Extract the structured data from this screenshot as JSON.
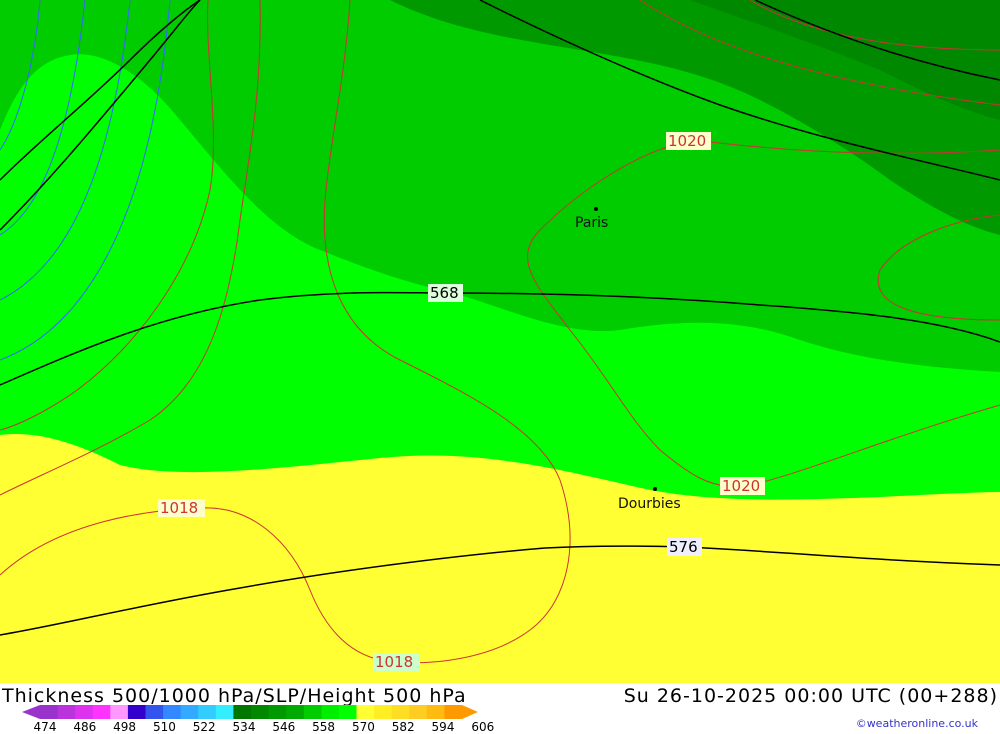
{
  "map": {
    "cities": [
      {
        "name": "Paris"
      },
      {
        "name": "Dourbies"
      }
    ],
    "height_labels": [
      "568",
      "576"
    ],
    "pressure_labels": [
      "1020",
      "1020",
      "1018",
      "1018"
    ],
    "colors": {
      "dark_green": "#009900",
      "mid_green": "#00cc00",
      "bright_green": "#00ff00",
      "yellow": "#ffff33",
      "height_contour": "#000000",
      "pressure_contour": "#cc3333",
      "thickness_contour": "#3366ff"
    }
  },
  "footer": {
    "title": "Thickness 500/1000 hPa/SLP/Height 500 hPa",
    "datetime": "Su 26-10-2025 00:00 UTC (00+288)",
    "credit": "©weatheronline.co.uk",
    "scale": {
      "ticks": [
        "474",
        "486",
        "498",
        "510",
        "522",
        "534",
        "546",
        "558",
        "570",
        "582",
        "594",
        "606"
      ],
      "colors": [
        "#9933cc",
        "#bb33dd",
        "#dd33ee",
        "#ff33ff",
        "#ff99ff",
        "#3300cc",
        "#3355ee",
        "#3388ff",
        "#33aaff",
        "#33ccff",
        "#33eeff",
        "#007700",
        "#008800",
        "#009900",
        "#00aa00",
        "#00cc00",
        "#00ee00",
        "#00ff00",
        "#ffff33",
        "#ffee22",
        "#ffdd22",
        "#ffcc22",
        "#ffbb11",
        "#ff9900"
      ]
    }
  }
}
